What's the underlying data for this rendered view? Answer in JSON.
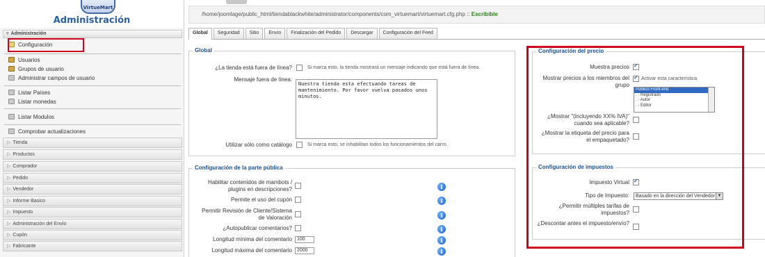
{
  "sidebar": {
    "logo_text": "VirtueMart",
    "title": "Administración",
    "section_header": "Administración",
    "items": [
      {
        "label": "Configuración"
      },
      {
        "label": "Usuarios"
      },
      {
        "label": "Grupos de usuario"
      },
      {
        "label": "Administrar campos de usuario"
      },
      {
        "label": "Listar Países"
      },
      {
        "label": "Listar monedas"
      },
      {
        "label": "Listar Modulos"
      },
      {
        "label": "Comprobar actualizaciones"
      }
    ],
    "categories": [
      "Tienda",
      "Productos",
      "Comprador",
      "Pedido",
      "Vendedor",
      "Informe Basico",
      "Impuesto",
      "Administración del Envío",
      "Cupón",
      "Fabricante"
    ]
  },
  "path": {
    "text": "/home/joomlage/public_html/tiendablackwhite/administrator/components/com_virtuemart/virtuemart.cfg.php :: ",
    "status": "Escribible"
  },
  "tabs": [
    "Global",
    "Seguridad",
    "Sitio",
    "Envío",
    "Finalización del Pedido",
    "Descargar",
    "Configuración del Feed"
  ],
  "global": {
    "legend": "Global",
    "offline_label": "¿La tienda está fuera de línea?",
    "offline_note": "Si marca esto, la tienda mostrará un mensaje indicando que está fuera de línea.",
    "message_label": "Mensaje fuera de línea:",
    "message_value": "Nuestra tienda esta efectuando tareas de mantenimiento. Por favor vuelva pasados unos minutos.",
    "catalog_label": "Utilizar sólo como catálogo",
    "catalog_note": "Si marca esto, se inhabilitan todos los funcionamientos del carro."
  },
  "public": {
    "legend": "Configuración de la parte pública",
    "mambots_label": "Habilitar contenidos de mambots / plugins en descripciones?",
    "coupon_label": "Permite el uso del cupón",
    "review_label": "Permitir Revisión de Cliente/Sistema de Valoración",
    "autopublish_label": "¿Autopublicar comentarios?",
    "min_label": "Longitud mínima del comentario",
    "min_value": "100",
    "max_label": "Longitud máxima del comentario",
    "max_value": "2000",
    "info_glyph": "i"
  },
  "price": {
    "legend": "Configuración del precio",
    "show_label": "Muestra precios",
    "members_label": "Mostrar precios a los miembros del grupo",
    "activate_label": "Activar esta característica",
    "groups": [
      "Público Front-end",
      ". - Registrado",
      ".      - Autor",
      ".           - Editor"
    ],
    "incl_label": "¿Mostrar \"(incluyendo XX% IVA)\" cuando sea aplicable?",
    "packaged_label": "¿Mostrar la etiqueta del precio para el empaquetado?"
  },
  "tax": {
    "legend": "Configuración de impuestos",
    "virtual_label": "Impuesto Virtual",
    "type_label": "Tipo de Impuesto:",
    "type_value": "Basado en la dirección del Vendedor",
    "multi_label": "¿Permitir múltiples tarifas de impuestos?",
    "discount_label": "¿Descontar antes el impuesto/envío?"
  }
}
